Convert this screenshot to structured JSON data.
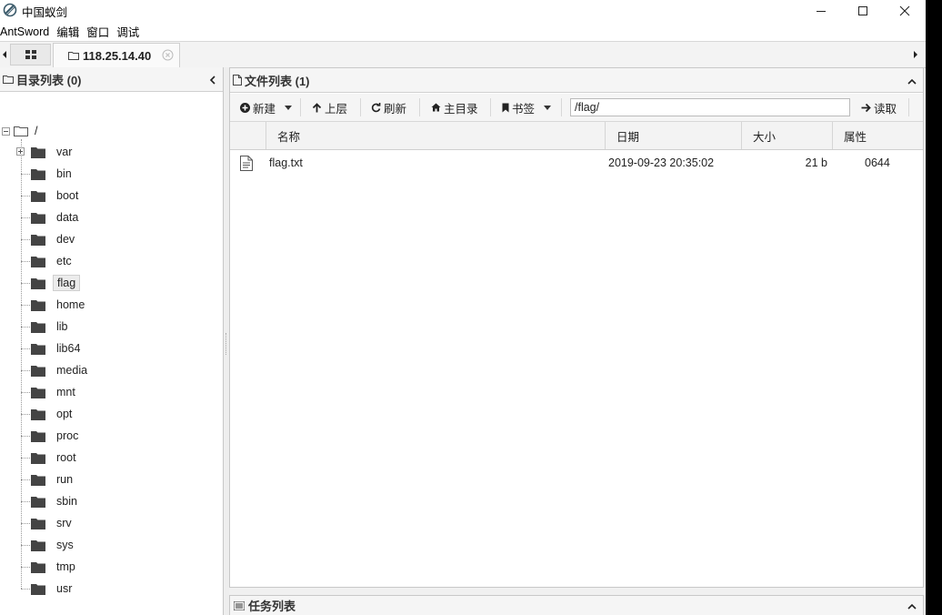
{
  "window": {
    "title": "中国蚁剑",
    "icons": {
      "app": "antsword-logo-icon",
      "minimize": "minimize-icon",
      "maximize": "maximize-icon",
      "close": "close-icon"
    }
  },
  "menu": [
    "AntSword",
    "编辑",
    "窗口",
    "调试"
  ],
  "tabs": {
    "home_icon": "grid-icon",
    "active": {
      "label": "118.25.14.40",
      "icon": "folder-icon",
      "close_icon": "close-circle-icon"
    }
  },
  "left_pane": {
    "title": "目录列表 (0)",
    "root": "/",
    "folders": [
      {
        "name": "var",
        "expandable": true
      },
      {
        "name": "bin"
      },
      {
        "name": "boot"
      },
      {
        "name": "data"
      },
      {
        "name": "dev"
      },
      {
        "name": "etc"
      },
      {
        "name": "flag",
        "selected": true
      },
      {
        "name": "home"
      },
      {
        "name": "lib"
      },
      {
        "name": "lib64"
      },
      {
        "name": "media"
      },
      {
        "name": "mnt"
      },
      {
        "name": "opt"
      },
      {
        "name": "proc"
      },
      {
        "name": "root"
      },
      {
        "name": "run"
      },
      {
        "name": "sbin"
      },
      {
        "name": "srv"
      },
      {
        "name": "sys"
      },
      {
        "name": "tmp"
      },
      {
        "name": "usr"
      }
    ]
  },
  "file_pane": {
    "title": "文件列表 (1)",
    "toolbar": {
      "new": "新建",
      "up": "上层",
      "refresh": "刷新",
      "home": "主目录",
      "bookmark": "书签",
      "path": "/flag/",
      "read": "读取"
    },
    "columns": {
      "name": "名称",
      "date": "日期",
      "size": "大小",
      "attr": "属性"
    },
    "files": [
      {
        "name": "flag.txt",
        "date": "2019-09-23 20:35:02",
        "size": "21 b",
        "attr": "0644",
        "icon": "text-file-icon"
      }
    ]
  },
  "task_pane": {
    "title": "任务列表"
  },
  "colors": {
    "accent": "#333333",
    "background": "#f0f0f0",
    "folder": "#444444"
  }
}
